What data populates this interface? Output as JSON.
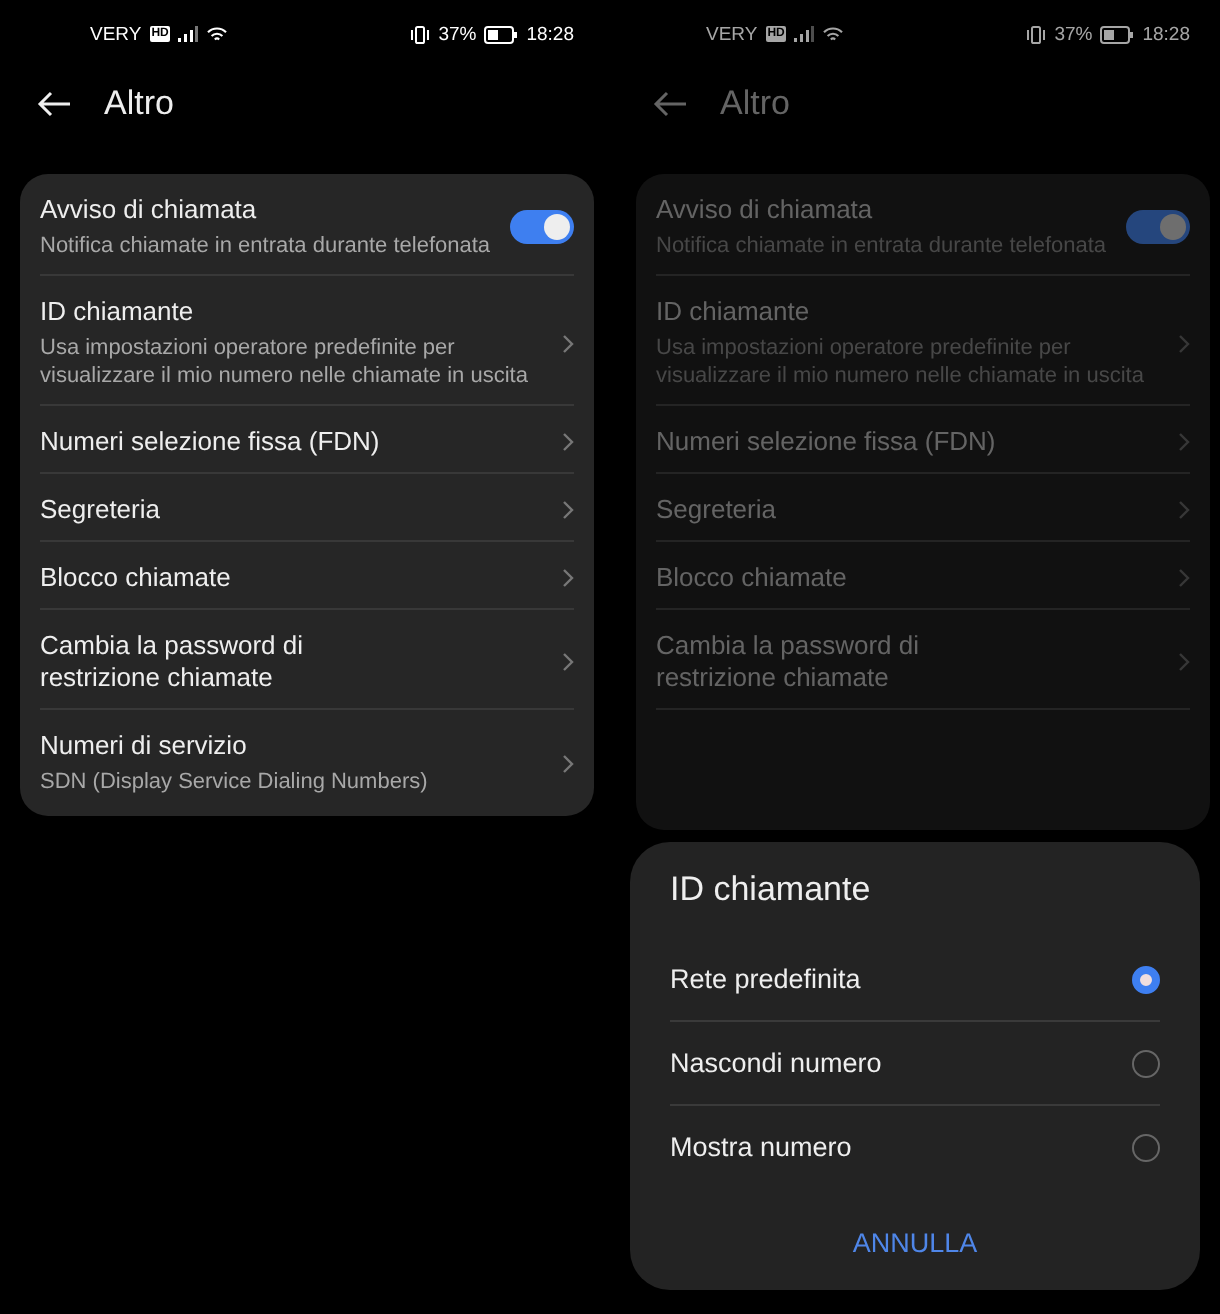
{
  "screens": [
    {
      "status_bar": {
        "carrier": "VERY",
        "badge": "HD",
        "battery": "37%",
        "time": "18:28"
      },
      "title": "Altro",
      "dimmed": false,
      "items": [
        {
          "kind": "toggle",
          "title": "Avviso di chiamata",
          "subtitle": "Notifica chiamate in entrata durante telefonata",
          "on": true
        },
        {
          "kind": "link",
          "title": "ID chiamante",
          "subtitle": "Usa impostazioni operatore predefinite per visualizzare il mio numero nelle chiamate in uscita"
        },
        {
          "kind": "link",
          "title": "Numeri selezione fissa (FDN)"
        },
        {
          "kind": "link",
          "title": "Segreteria"
        },
        {
          "kind": "link",
          "title": "Blocco chiamate"
        },
        {
          "kind": "link",
          "title": "Cambia la password di restrizione chiamate"
        },
        {
          "kind": "link",
          "title": "Numeri di servizio",
          "subtitle": "SDN (Display Service Dialing Numbers)"
        }
      ]
    },
    {
      "status_bar": {
        "carrier": "VERY",
        "badge": "HD",
        "battery": "37%",
        "time": "18:28"
      },
      "title": "Altro",
      "dimmed": true,
      "items": [
        {
          "kind": "toggle",
          "title": "Avviso di chiamata",
          "subtitle": "Notifica chiamate in entrata durante telefonata",
          "on": true
        },
        {
          "kind": "link",
          "title": "ID chiamante",
          "subtitle": "Usa impostazioni operatore predefinite per visualizzare il mio numero nelle chiamate in uscita"
        },
        {
          "kind": "link",
          "title": "Numeri selezione fissa (FDN)"
        },
        {
          "kind": "link",
          "title": "Segreteria"
        },
        {
          "kind": "link",
          "title": "Blocco chiamate"
        },
        {
          "kind": "link",
          "title": "Cambia la password di restrizione chiamate"
        }
      ],
      "dialog": {
        "title": "ID chiamante",
        "options": [
          {
            "label": "Rete predefinita",
            "selected": true
          },
          {
            "label": "Nascondi numero",
            "selected": false
          },
          {
            "label": "Mostra numero",
            "selected": false
          }
        ],
        "cancel": "ANNULLA"
      }
    }
  ]
}
